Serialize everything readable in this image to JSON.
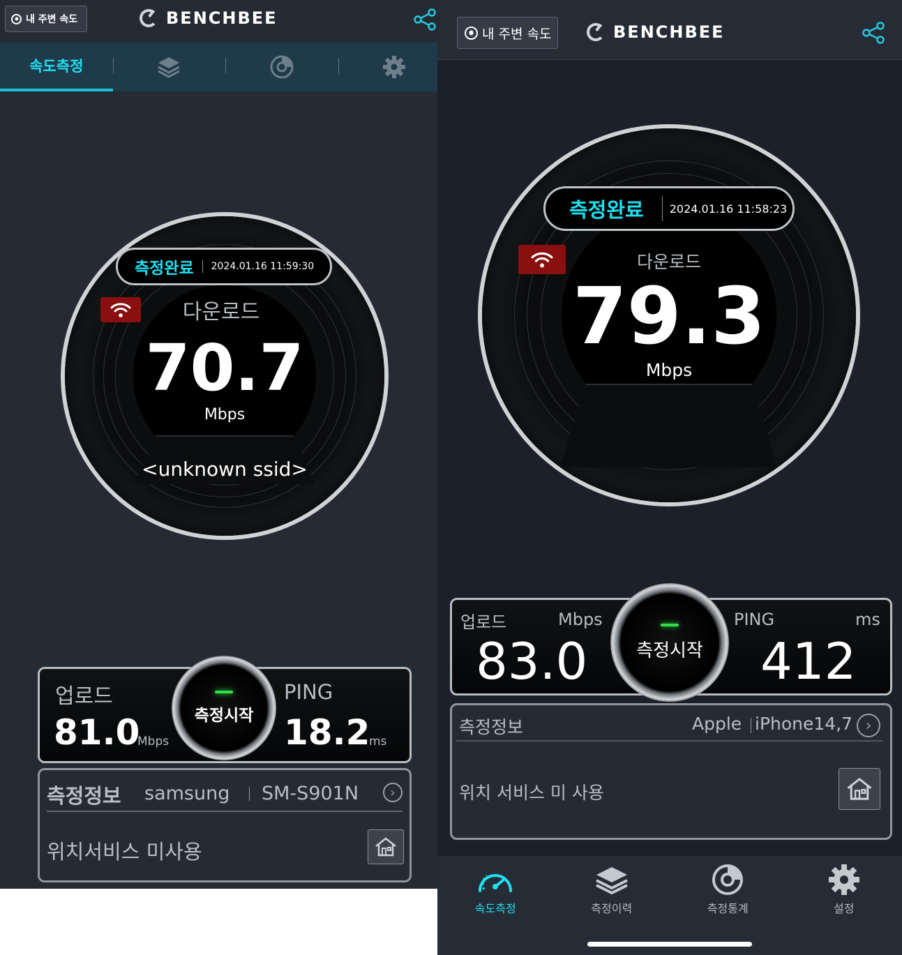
{
  "left": {
    "header": {
      "nearby_label": "내 주변 속도",
      "logo_text": "BENCHBEE"
    },
    "tabs": {
      "speed_label": "속도측정"
    },
    "gauge": {
      "status": "측정완료",
      "datetime": "2024.01.16 11:59:30",
      "download_label": "다운로드",
      "download_value": "70.7",
      "unit": "Mbps",
      "ssid": "<unknown ssid>"
    },
    "metrics": {
      "upload_label": "업로드",
      "upload_value": "81.0",
      "upload_unit": "Mbps",
      "start_label": "측정시작",
      "ping_label": "PING",
      "ping_value": "18.2",
      "ping_unit": "ms"
    },
    "info": {
      "title": "측정정보",
      "maker": "samsung",
      "model": "SM-S901N",
      "location": "위치서비스 미사용"
    }
  },
  "right": {
    "header": {
      "nearby_label": "내 주변 속도",
      "logo_text": "BENCHBEE"
    },
    "gauge": {
      "status": "측정완료",
      "datetime": "2024.01.16 11:58:23",
      "download_label": "다운로드",
      "download_value": "79.3",
      "unit": "Mbps"
    },
    "metrics": {
      "upload_label": "업로드",
      "upload_unit": "Mbps",
      "upload_value": "83.0",
      "start_label": "측정시작",
      "ping_label": "PING",
      "ping_unit": "ms",
      "ping_value": "412"
    },
    "info": {
      "title": "측정정보",
      "maker": "Apple",
      "model": "iPhone14,7",
      "location": "위치 서비스 미 사용"
    },
    "bottom_nav": [
      {
        "label": "속도측정",
        "icon": "speedometer-icon"
      },
      {
        "label": "측정이력",
        "icon": "layers-icon"
      },
      {
        "label": "측정통계",
        "icon": "chart-disc-icon"
      },
      {
        "label": "설정",
        "icon": "gear-icon"
      }
    ]
  },
  "colors": {
    "accent": "#1ee0f0",
    "badge": "#8a1010",
    "led": "#2fe04a"
  }
}
